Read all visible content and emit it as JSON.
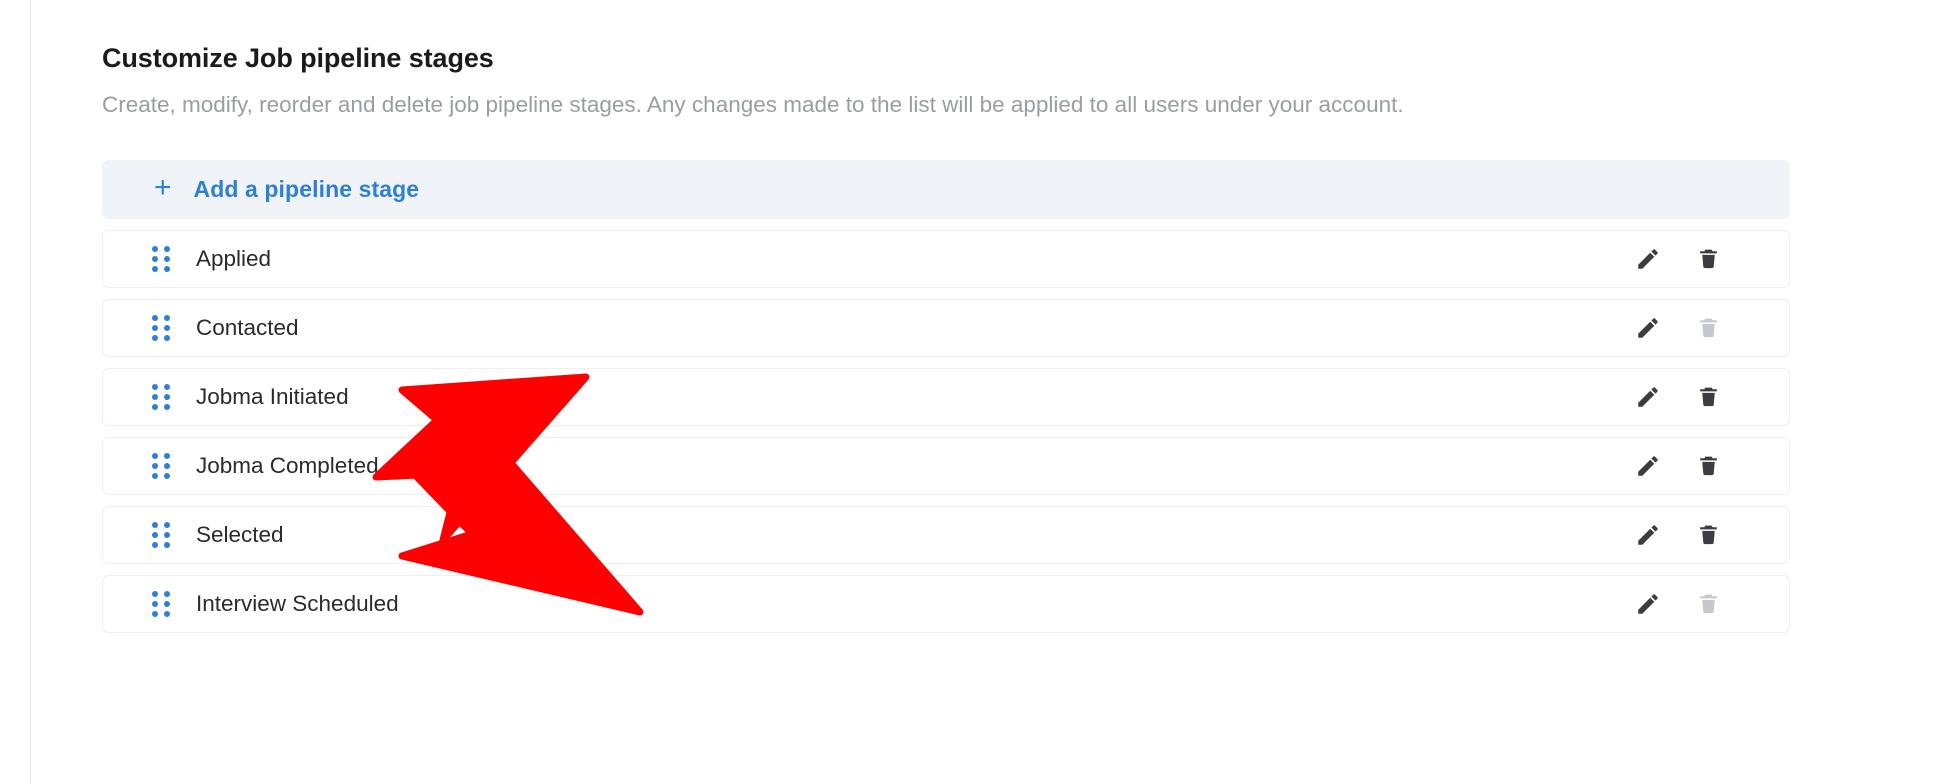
{
  "header": {
    "title": "Customize Job pipeline stages",
    "subtitle": "Create, modify, reorder and delete job pipeline stages. Any changes made to the list will be applied to all users under your account."
  },
  "add_stage": {
    "plus_glyph": "+",
    "label": "Add a pipeline stage",
    "icon": "plus-icon",
    "background_color": "#f0f3f7",
    "text_color": "#2f7fd4"
  },
  "stages": [
    {
      "label": "Applied",
      "drag_handle_icon": "drag-dots-icon",
      "edit_icon": "pencil-icon",
      "delete_icon": "trash-icon",
      "delete_enabled": true
    },
    {
      "label": "Contacted",
      "drag_handle_icon": "drag-dots-icon",
      "edit_icon": "pencil-icon",
      "delete_icon": "trash-icon",
      "delete_enabled": false
    },
    {
      "label": "Jobma Initiated",
      "drag_handle_icon": "drag-dots-icon",
      "edit_icon": "pencil-icon",
      "delete_icon": "trash-icon",
      "delete_enabled": true
    },
    {
      "label": "Jobma Completed",
      "drag_handle_icon": "drag-dots-icon",
      "edit_icon": "pencil-icon",
      "delete_icon": "trash-icon",
      "delete_enabled": true
    },
    {
      "label": "Selected",
      "drag_handle_icon": "drag-dots-icon",
      "edit_icon": "pencil-icon",
      "delete_icon": "trash-icon",
      "delete_enabled": true
    },
    {
      "label": "Interview Scheduled",
      "drag_handle_icon": "drag-dots-icon",
      "edit_icon": "pencil-icon",
      "delete_icon": "trash-icon",
      "delete_enabled": false
    }
  ],
  "annotations": {
    "color": "#ff0000",
    "arrows": [
      {
        "name": "arrow-pointing-jobma-initiated",
        "points_at": "Jobma Initiated"
      },
      {
        "name": "arrow-pointing-jobma-completed",
        "points_at": "Jobma Completed"
      }
    ]
  },
  "colors": {
    "accent_blue": "#2f7fd4",
    "row_border": "#eaeff5",
    "icon_enabled": "#3c3c41",
    "icon_disabled": "#c6c8cb",
    "title": "#1b1b1f",
    "subtitle": "#9a9da3"
  }
}
